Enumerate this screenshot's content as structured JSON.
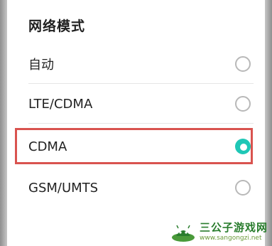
{
  "dialog": {
    "title": "网络模式",
    "options": [
      {
        "label": "自动",
        "selected": false
      },
      {
        "label": "LTE/CDMA",
        "selected": false
      },
      {
        "label": "CDMA",
        "selected": true
      },
      {
        "label": "GSM/UMTS",
        "selected": false
      }
    ]
  },
  "colors": {
    "accent": "#1fc7b6",
    "highlight_border": "#d9534f",
    "watermark_green": "#2a7d2e"
  },
  "watermark": {
    "title": "三公子游戏网",
    "url": "www.sangongzi.net",
    "icon": "android-logo-icon"
  }
}
